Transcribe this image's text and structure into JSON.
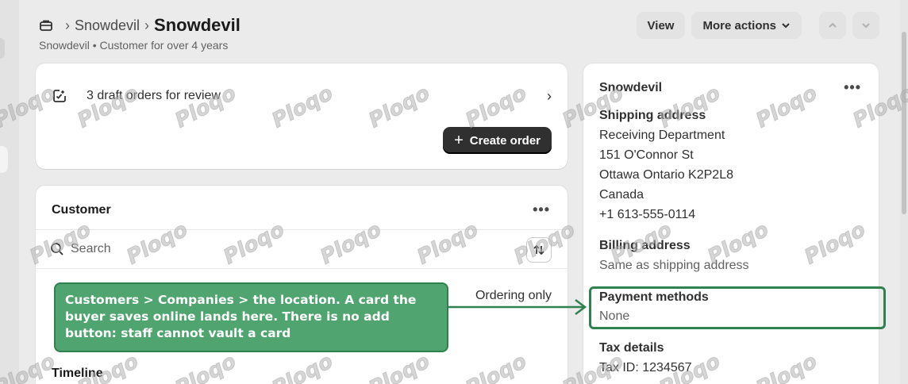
{
  "breadcrumb": {
    "parent": "Snowdevil",
    "title": "Snowdevil",
    "subtitle": "Snowdevil • Customer for over 4 years"
  },
  "header_actions": {
    "view": "View",
    "more_actions": "More actions"
  },
  "drafts_card": {
    "text": "3 draft orders for review",
    "create_order": "Create order"
  },
  "customer_card": {
    "title": "Customer",
    "search_placeholder": "Search",
    "row_status": "Ordering only",
    "timeline_title": "Timeline"
  },
  "company_card": {
    "name": "Snowdevil",
    "shipping_label": "Shipping address",
    "shipping_lines": [
      "Receiving Department",
      "151 O'Connor St",
      "Ottawa Ontario K2P2L8",
      "Canada",
      "+1 613-555-0114"
    ],
    "billing_label": "Billing address",
    "billing_value": "Same as shipping address",
    "payment_label": "Payment methods",
    "payment_value": "None",
    "tax_label": "Tax details",
    "tax_id": "Tax ID: 1234567"
  },
  "annotation": {
    "text": "Customers > Companies > the location. A card the buyer saves online lands here. There is no add button: staff cannot vault a card",
    "color": "#4fa46f",
    "border_color": "#2f8150"
  },
  "watermark": "Ploqo"
}
